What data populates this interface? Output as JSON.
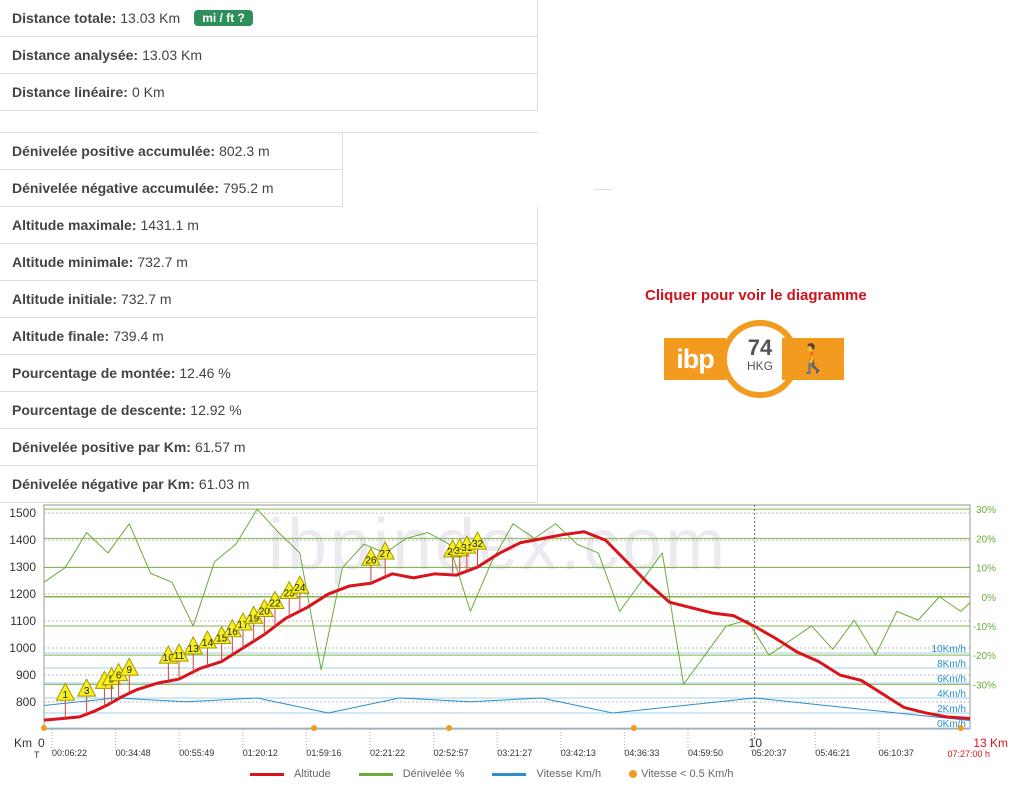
{
  "stats1": [
    {
      "label": "Distance totale:",
      "value": "13.03 Km"
    },
    {
      "label": "Distance analysée:",
      "value": "13.03 Km"
    },
    {
      "label": "Distance linéaire:",
      "value": "0 Km"
    }
  ],
  "unit_button": "mi / ft ?",
  "stats2": [
    {
      "label": "Dénivelée positive accumulée:",
      "value": "802.3 m"
    },
    {
      "label": "Dénivelée négative accumulée:",
      "value": "795.2 m"
    },
    {
      "label": "Altitude maximale:",
      "value": "1431.1 m"
    },
    {
      "label": "Altitude minimale:",
      "value": "732.7 m"
    },
    {
      "label": "Altitude initiale:",
      "value": "732.7 m"
    },
    {
      "label": "Altitude finale:",
      "value": "739.4 m"
    },
    {
      "label": "Pourcentage de montée:",
      "value": "12.46 %"
    },
    {
      "label": "Pourcentage de descente:",
      "value": "12.92 %"
    },
    {
      "label": "Dénivelée positive par Km:",
      "value": "61.57 m"
    },
    {
      "label": "Dénivelée négative par Km:",
      "value": "61.03 m"
    }
  ],
  "ibp": {
    "caption": "Cliquer pour voir le diagramme",
    "logo": "ibp",
    "score": "74",
    "code": "HKG",
    "icon": "hiker-icon"
  },
  "chart_data": {
    "type": "line",
    "watermark": "ibpindex.com",
    "xlim": [
      0,
      13.03
    ],
    "ylim": [
      700,
      1530
    ],
    "y_ticks": [
      800,
      900,
      1000,
      1100,
      1200,
      1300,
      1400,
      1500
    ],
    "grade_ticks": [
      "30%",
      "20%",
      "10%",
      "0%",
      "-10%",
      "-20%",
      "-30%"
    ],
    "grade_values": [
      30,
      20,
      10,
      0,
      -10,
      -20,
      -30
    ],
    "speed_ticks": [
      "10Km/h",
      "8Km/h",
      "6Km/h",
      "4Km/h",
      "2Km/h",
      "0Km/h"
    ],
    "speed_values": [
      10,
      8,
      6,
      4,
      2,
      0
    ],
    "x_axis_label": "Km",
    "x_start_label": "0",
    "x_mid": {
      "label": "10",
      "km": 10
    },
    "x_end_label": "13 Km",
    "time_label": "T",
    "end_time": "07:27:00 h",
    "time_ticks": [
      "00:06:22",
      "00:34:48",
      "00:55:49",
      "01:20:12",
      "01:59:16",
      "02:21:22",
      "02:52:57",
      "03:21:27",
      "03:42:13",
      "04:36:33",
      "04:59:50",
      "05:20:37",
      "05:46:21",
      "06:10:37"
    ],
    "series": [
      {
        "name": "Altitude",
        "color": "#d8141c",
        "x": [
          0,
          0.3,
          0.5,
          0.7,
          0.9,
          1.1,
          1.3,
          1.6,
          1.9,
          2.2,
          2.5,
          2.8,
          3.1,
          3.4,
          3.7,
          4.0,
          4.3,
          4.6,
          4.9,
          5.2,
          5.5,
          5.8,
          6.1,
          6.4,
          6.7,
          7.0,
          7.3,
          7.6,
          7.9,
          8.2,
          8.5,
          8.8,
          9.1,
          9.4,
          9.7,
          10.0,
          10.3,
          10.6,
          10.9,
          11.2,
          11.5,
          11.8,
          12.1,
          12.4,
          12.7,
          13.03
        ],
        "y": [
          733,
          740,
          745,
          765,
          790,
          820,
          845,
          870,
          885,
          925,
          950,
          1000,
          1050,
          1110,
          1150,
          1200,
          1230,
          1240,
          1275,
          1260,
          1275,
          1270,
          1300,
          1350,
          1390,
          1405,
          1420,
          1431,
          1400,
          1320,
          1240,
          1170,
          1150,
          1130,
          1120,
          1080,
          1035,
          985,
          950,
          900,
          880,
          830,
          780,
          760,
          745,
          739
        ]
      },
      {
        "name": "Dénivelée %",
        "color": "#6aab3a",
        "x": [
          0,
          0.3,
          0.6,
          0.9,
          1.2,
          1.5,
          1.8,
          2.1,
          2.4,
          2.7,
          3.0,
          3.3,
          3.6,
          3.9,
          4.2,
          4.5,
          4.8,
          5.1,
          5.4,
          5.7,
          6.0,
          6.3,
          6.6,
          6.9,
          7.2,
          7.5,
          7.8,
          8.1,
          8.4,
          8.7,
          9.0,
          9.3,
          9.6,
          9.9,
          10.2,
          10.5,
          10.8,
          11.1,
          11.4,
          11.7,
          12.0,
          12.3,
          12.6,
          12.9,
          13.03
        ],
        "y": [
          5,
          10,
          22,
          15,
          25,
          8,
          5,
          -10,
          12,
          18,
          30,
          22,
          15,
          -25,
          10,
          18,
          15,
          20,
          22,
          18,
          -5,
          12,
          25,
          20,
          25,
          18,
          15,
          -5,
          5,
          15,
          -30,
          -20,
          -10,
          -8,
          -20,
          -15,
          -10,
          -18,
          -8,
          -20,
          -5,
          -8,
          0,
          -5,
          -2
        ]
      },
      {
        "name": "Vitesse Km/h",
        "color": "#2b8fcf",
        "x": [
          0,
          1,
          2,
          3,
          4,
          5,
          6,
          7,
          8,
          9,
          10,
          11,
          12,
          13.03
        ],
        "y": [
          3,
          4,
          3.5,
          4,
          2,
          4,
          3.5,
          4,
          2,
          3,
          4,
          3,
          2,
          1
        ]
      },
      {
        "name": "Vitesse < 0.5 Km/h",
        "color": "#f39b1f",
        "x": [
          0,
          3.8,
          5.7,
          8.3,
          12.9
        ],
        "y": [
          0,
          0,
          0,
          0,
          0
        ]
      }
    ],
    "markers": [
      "1",
      "3",
      "4",
      "5",
      "6",
      "9",
      "10",
      "11",
      "13",
      "14",
      "15",
      "16",
      "17",
      "19",
      "20",
      "22",
      "23",
      "24",
      "26",
      "27",
      "29",
      "30",
      "31",
      "32"
    ],
    "marker_km": [
      0.3,
      0.6,
      0.85,
      0.95,
      1.05,
      1.2,
      1.75,
      1.9,
      2.1,
      2.3,
      2.5,
      2.65,
      2.8,
      2.95,
      3.1,
      3.25,
      3.45,
      3.6,
      4.6,
      4.8,
      5.75,
      5.85,
      5.95,
      6.1
    ],
    "legend_position": "bottom"
  }
}
